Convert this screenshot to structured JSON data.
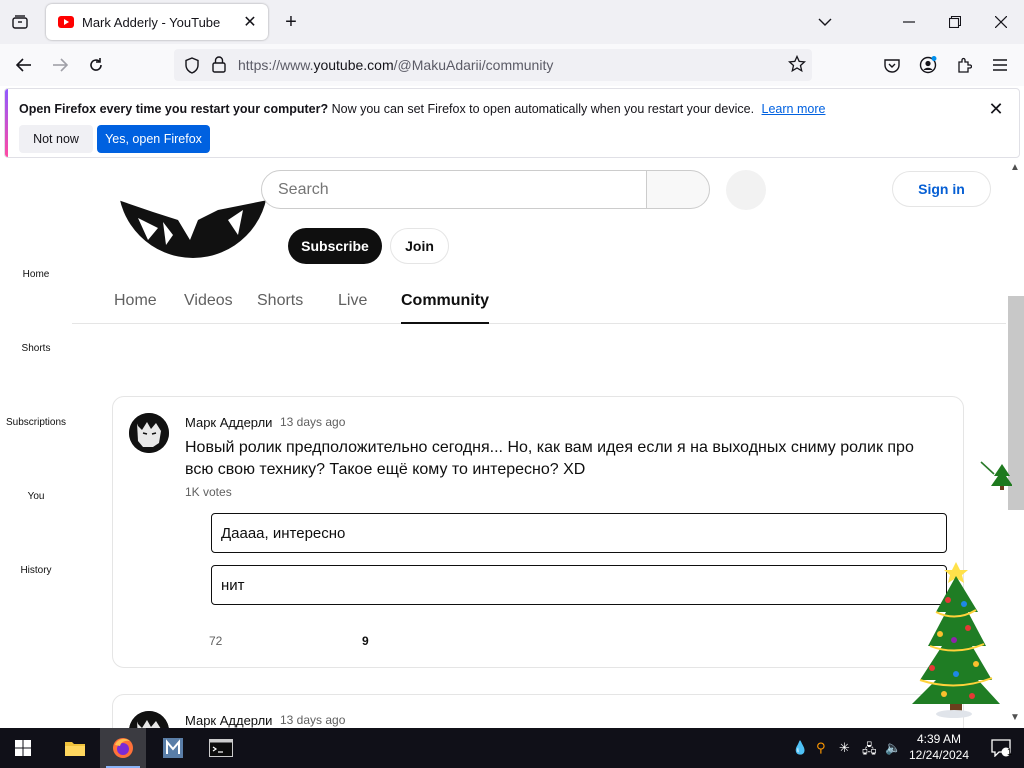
{
  "browser": {
    "tab_title": "Mark Adderly - YouTube",
    "url_prefix": "https://www.",
    "url_host": "youtube.com",
    "url_path": "/@MakuAdarii/community"
  },
  "notification": {
    "bold": "Open Firefox every time you restart your computer?",
    "text": "Now you can set Firefox to open automatically when you restart your device.",
    "learn_more": "Learn more",
    "not_now": "Not now",
    "yes_open": "Yes, open Firefox"
  },
  "youtube": {
    "search_placeholder": "Search",
    "sign_in": "Sign in",
    "subscribe": "Subscribe",
    "join": "Join",
    "sidebar": [
      "Home",
      "Shorts",
      "Subscriptions",
      "You",
      "History"
    ],
    "tabs": [
      "Home",
      "Videos",
      "Shorts",
      "Live",
      "Community"
    ],
    "active_tab": "Community"
  },
  "posts": [
    {
      "author": "Марк Аддерли",
      "time": "13 days ago",
      "text": "Новый ролик предположительно сегодня...  Но, как вам идея если я на выходных сниму ролик про всю свою технику? Такое ещё кому то интересно? XD",
      "votes": "1K votes",
      "options": [
        "Даааа, интересно",
        "нит"
      ],
      "likes": "72",
      "comments": "9"
    },
    {
      "author": "Марк Аддерли",
      "time": "13 days ago"
    }
  ],
  "taskbar": {
    "time": "4:39 AM",
    "date": "12/24/2024",
    "notification_count": "1"
  },
  "colors": {
    "youtube_red": "#ff0000",
    "firefox_blue": "#0061e0",
    "link_blue": "#065fd4"
  }
}
